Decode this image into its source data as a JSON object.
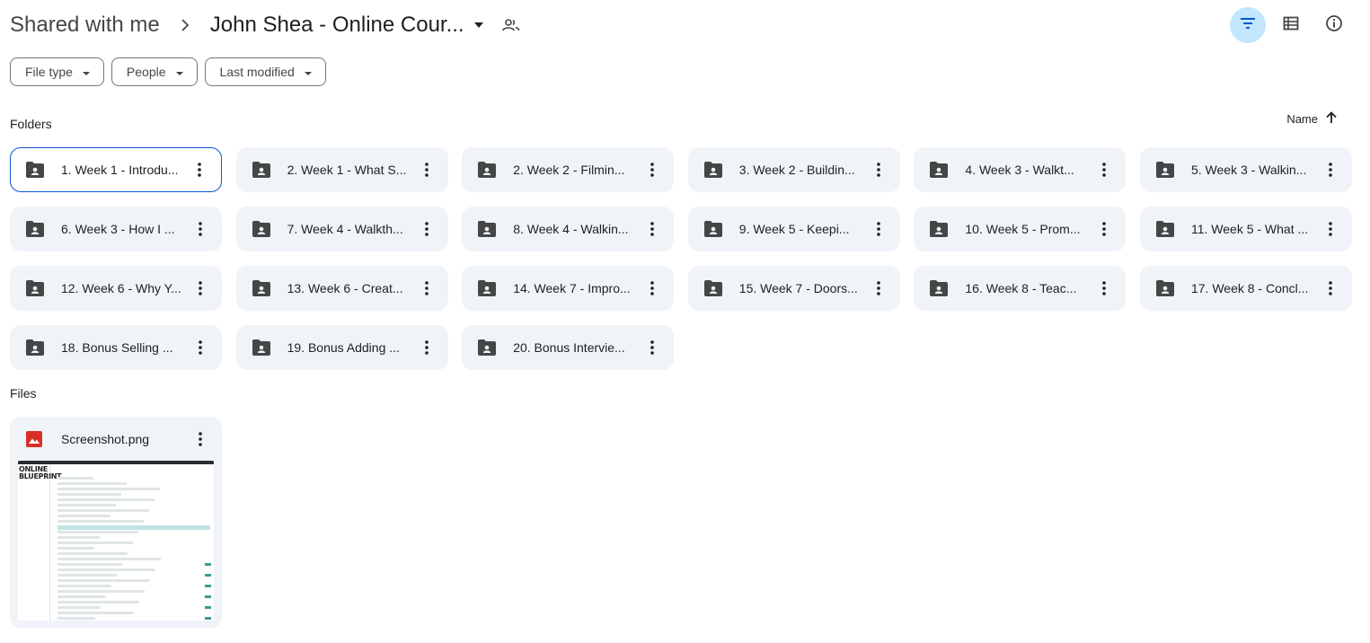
{
  "breadcrumb": {
    "root": "Shared with me",
    "current": "John Shea - Online Cour..."
  },
  "toolbar": {
    "filter_icon": "filter-icon",
    "list_view_icon": "list-view-icon",
    "details_icon": "info-icon"
  },
  "filters": {
    "file_type": "File type",
    "people": "People",
    "last_modified": "Last modified"
  },
  "sections": {
    "folders": "Folders",
    "files": "Files"
  },
  "sort": {
    "label": "Name",
    "direction": "ascending"
  },
  "folders": [
    "1. Week 1 - Introdu...",
    "2. Week 1 - What S...",
    "2. Week 2 - Filmin...",
    "3. Week 2 - Buildin...",
    "4. Week 3 - Walkt...",
    "5. Week 3 - Walkin...",
    "6. Week 3 - How I ...",
    "7. Week 4 - Walkth...",
    "8. Week 4 - Walkin...",
    "9. Week 5 - Keepi...",
    "10. Week 5 - Prom...",
    "11. Week 5 - What ...",
    "12. Week 6 - Why Y...",
    "13. Week 6 - Creat...",
    "14. Week 7 - Impro...",
    "15. Week 7 - Doors...",
    "16. Week 8 - Teac...",
    "17. Week 8 - Concl...",
    "18. Bonus Selling ...",
    "19. Bonus Adding ...",
    "20. Bonus Intervie..."
  ],
  "selected_folder_index": 0,
  "files": [
    {
      "name": "Screenshot.png",
      "icon": "image-icon"
    }
  ],
  "thumbnail": {
    "logo_line1": "ONLINE",
    "logo_line2": "BLUEPRINT"
  },
  "colors": {
    "accent": "#0b57d0",
    "active_button": "#c2e7ff",
    "card_bg": "#f0f4f9",
    "image_icon": "#d93025"
  }
}
